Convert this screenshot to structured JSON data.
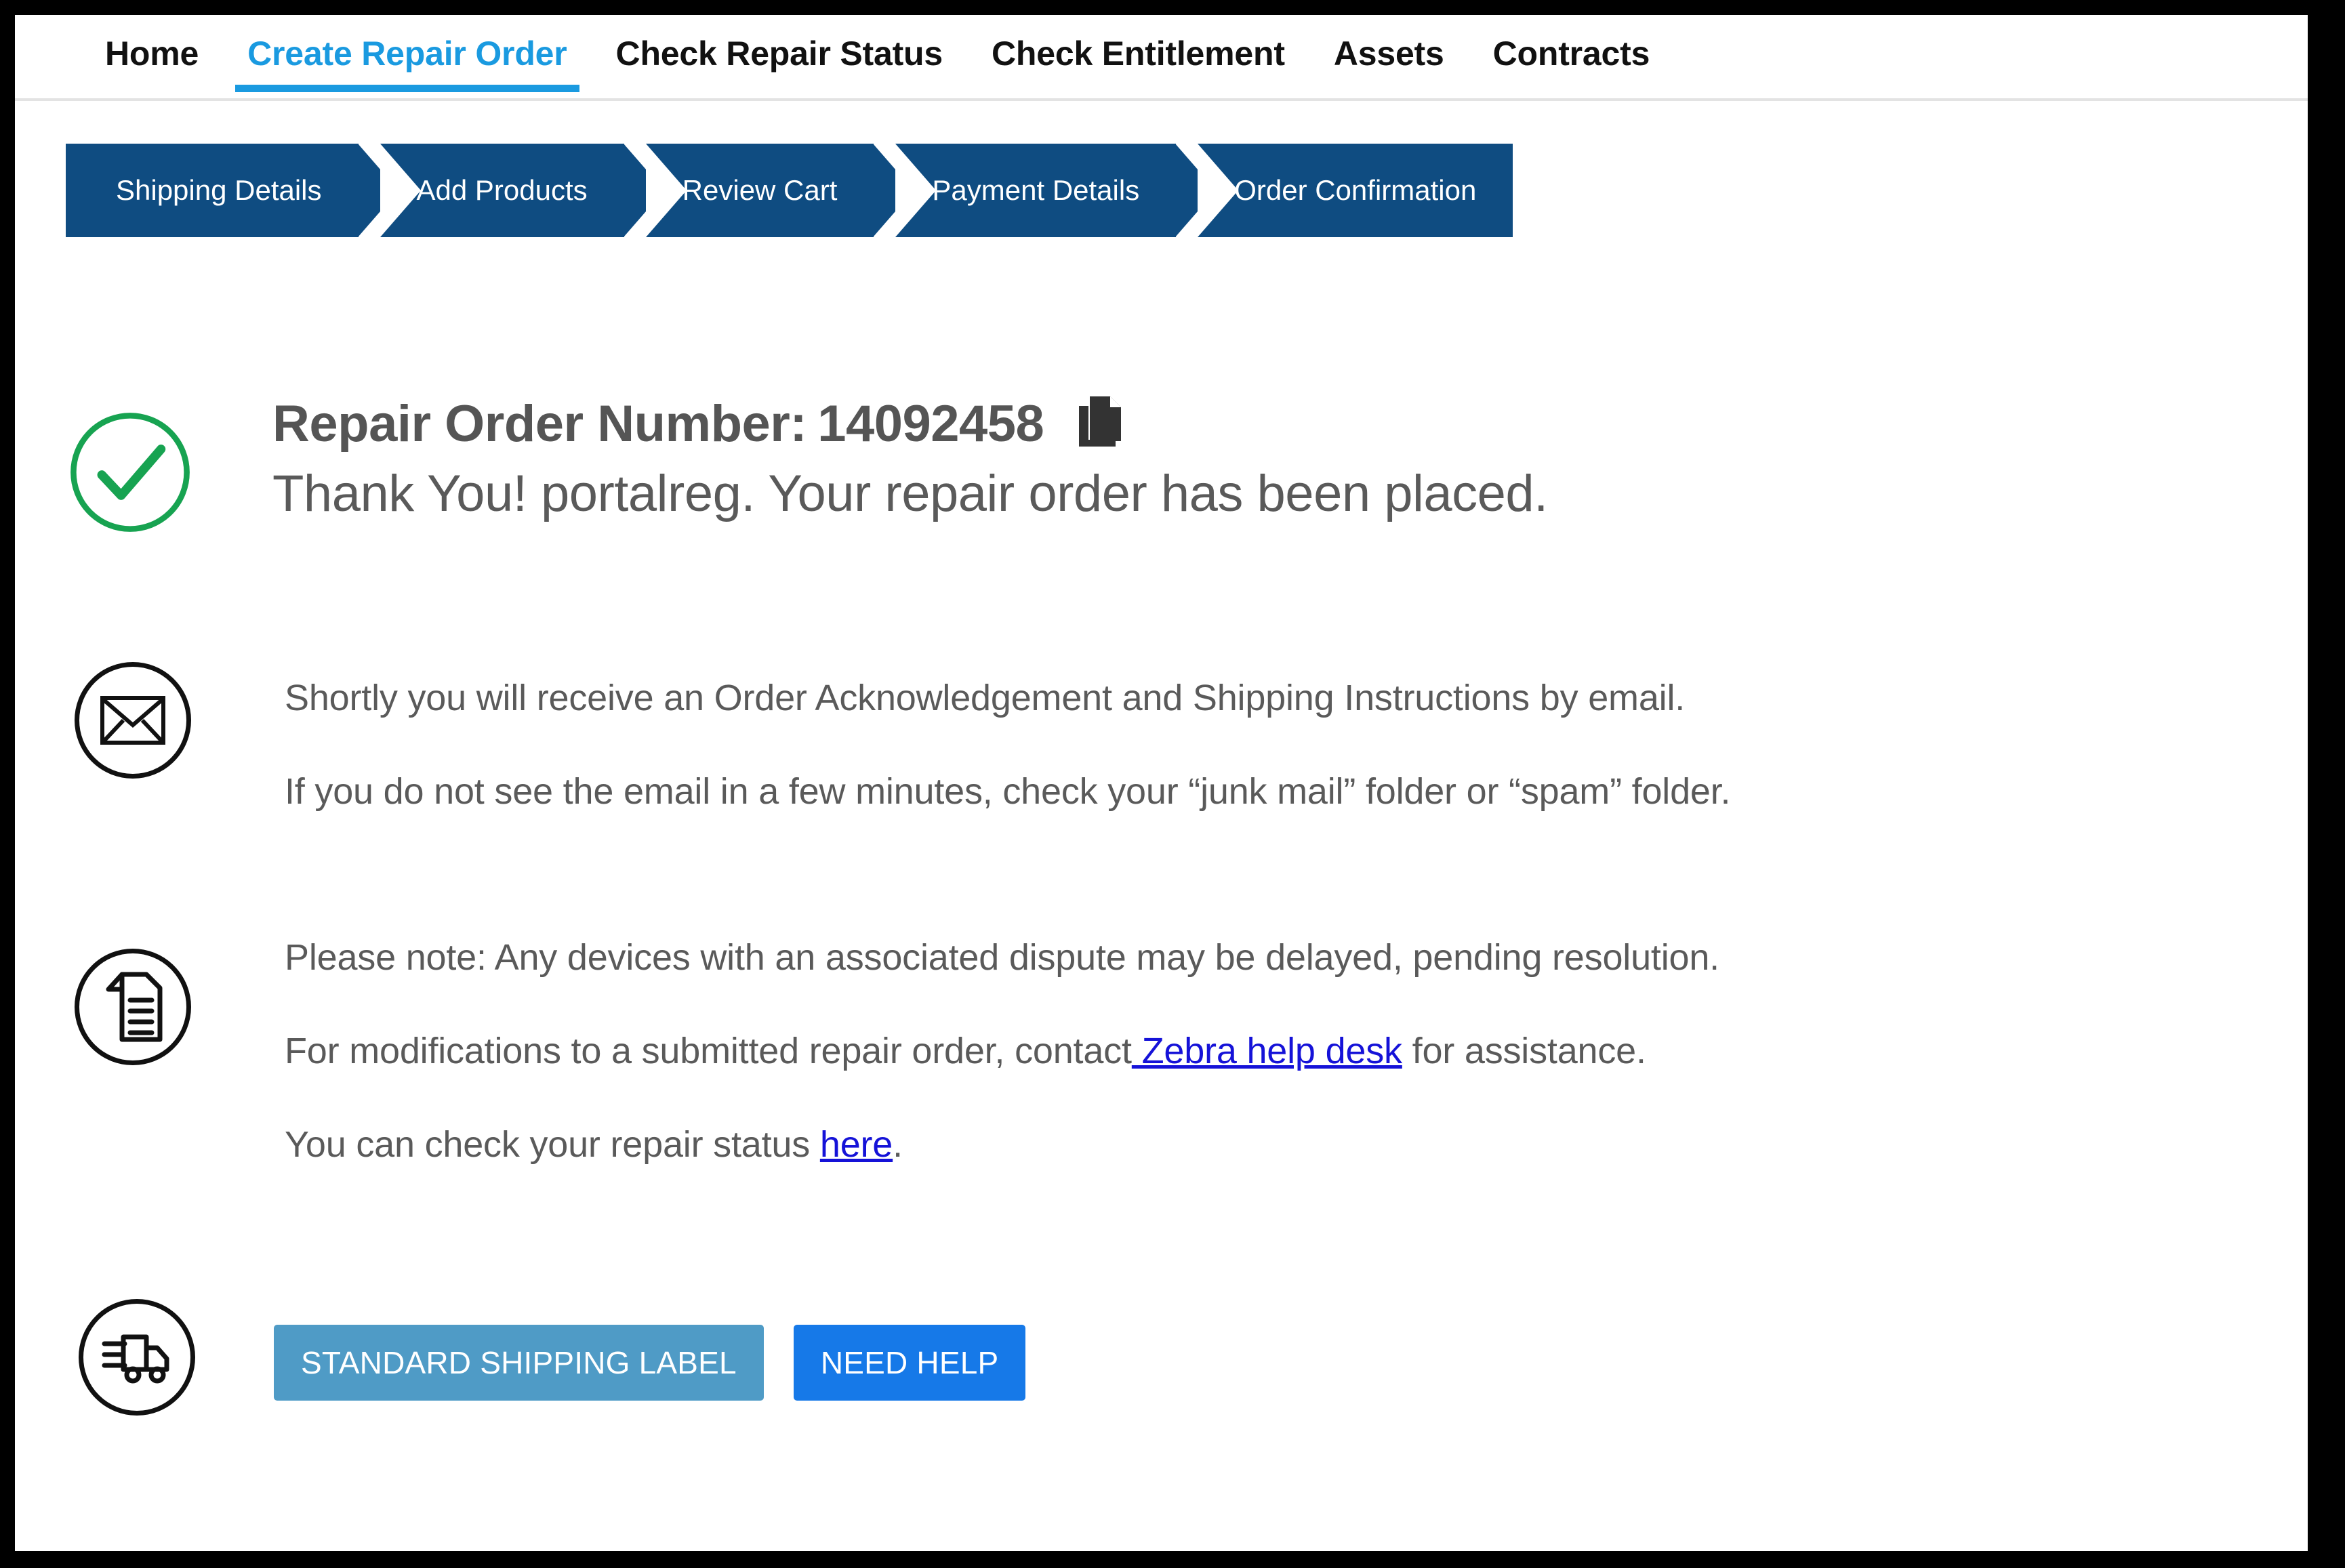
{
  "nav": {
    "items": [
      {
        "label": "Home",
        "active": false
      },
      {
        "label": "Create Repair Order",
        "active": true
      },
      {
        "label": "Check Repair Status",
        "active": false
      },
      {
        "label": "Check Entitlement",
        "active": false
      },
      {
        "label": "Assets",
        "active": false
      },
      {
        "label": "Contracts",
        "active": false
      }
    ]
  },
  "stepper": {
    "steps": [
      {
        "label": "Shipping Details"
      },
      {
        "label": "Add Products"
      },
      {
        "label": "Review Cart"
      },
      {
        "label": "Payment Details"
      },
      {
        "label": "Order Confirmation"
      }
    ]
  },
  "confirmation": {
    "status_icon": "check-circle-icon",
    "order_label": "Repair Order Number:",
    "order_number": "14092458",
    "copy_icon": "copy-icon",
    "thank_you": "Thank You! portalreg. Your repair order has been placed."
  },
  "email_block": {
    "icon": "envelope-icon",
    "line1": "Shortly you will receive an Order Acknowledgement and Shipping Instructions by email.",
    "line2": "If you do not see the email in a few minutes, check your “junk mail” folder or “spam” folder."
  },
  "note_block": {
    "icon": "document-icon",
    "line1": "Please note: Any devices with an associated dispute may be delayed, pending resolution.",
    "line2_prefix": "For modifications to a submitted repair order, contact",
    "line2_link": " Zebra help desk",
    "line2_suffix": " for assistance.",
    "line3_prefix": "You can check your repair status ",
    "line3_link": "here",
    "line3_suffix": "."
  },
  "shipping_block": {
    "icon": "truck-icon",
    "shipping_label_button": "STANDARD SHIPPING LABEL",
    "need_help_button": "NEED HELP"
  },
  "colors": {
    "accent_blue": "#1a9ae0",
    "stepper_navy": "#0f4c81",
    "success_green": "#17a351",
    "link_blue": "#1512d8",
    "primary_button": "#1679e8",
    "secondary_button": "#4f9bc6",
    "body_text": "#5a5a5a"
  }
}
